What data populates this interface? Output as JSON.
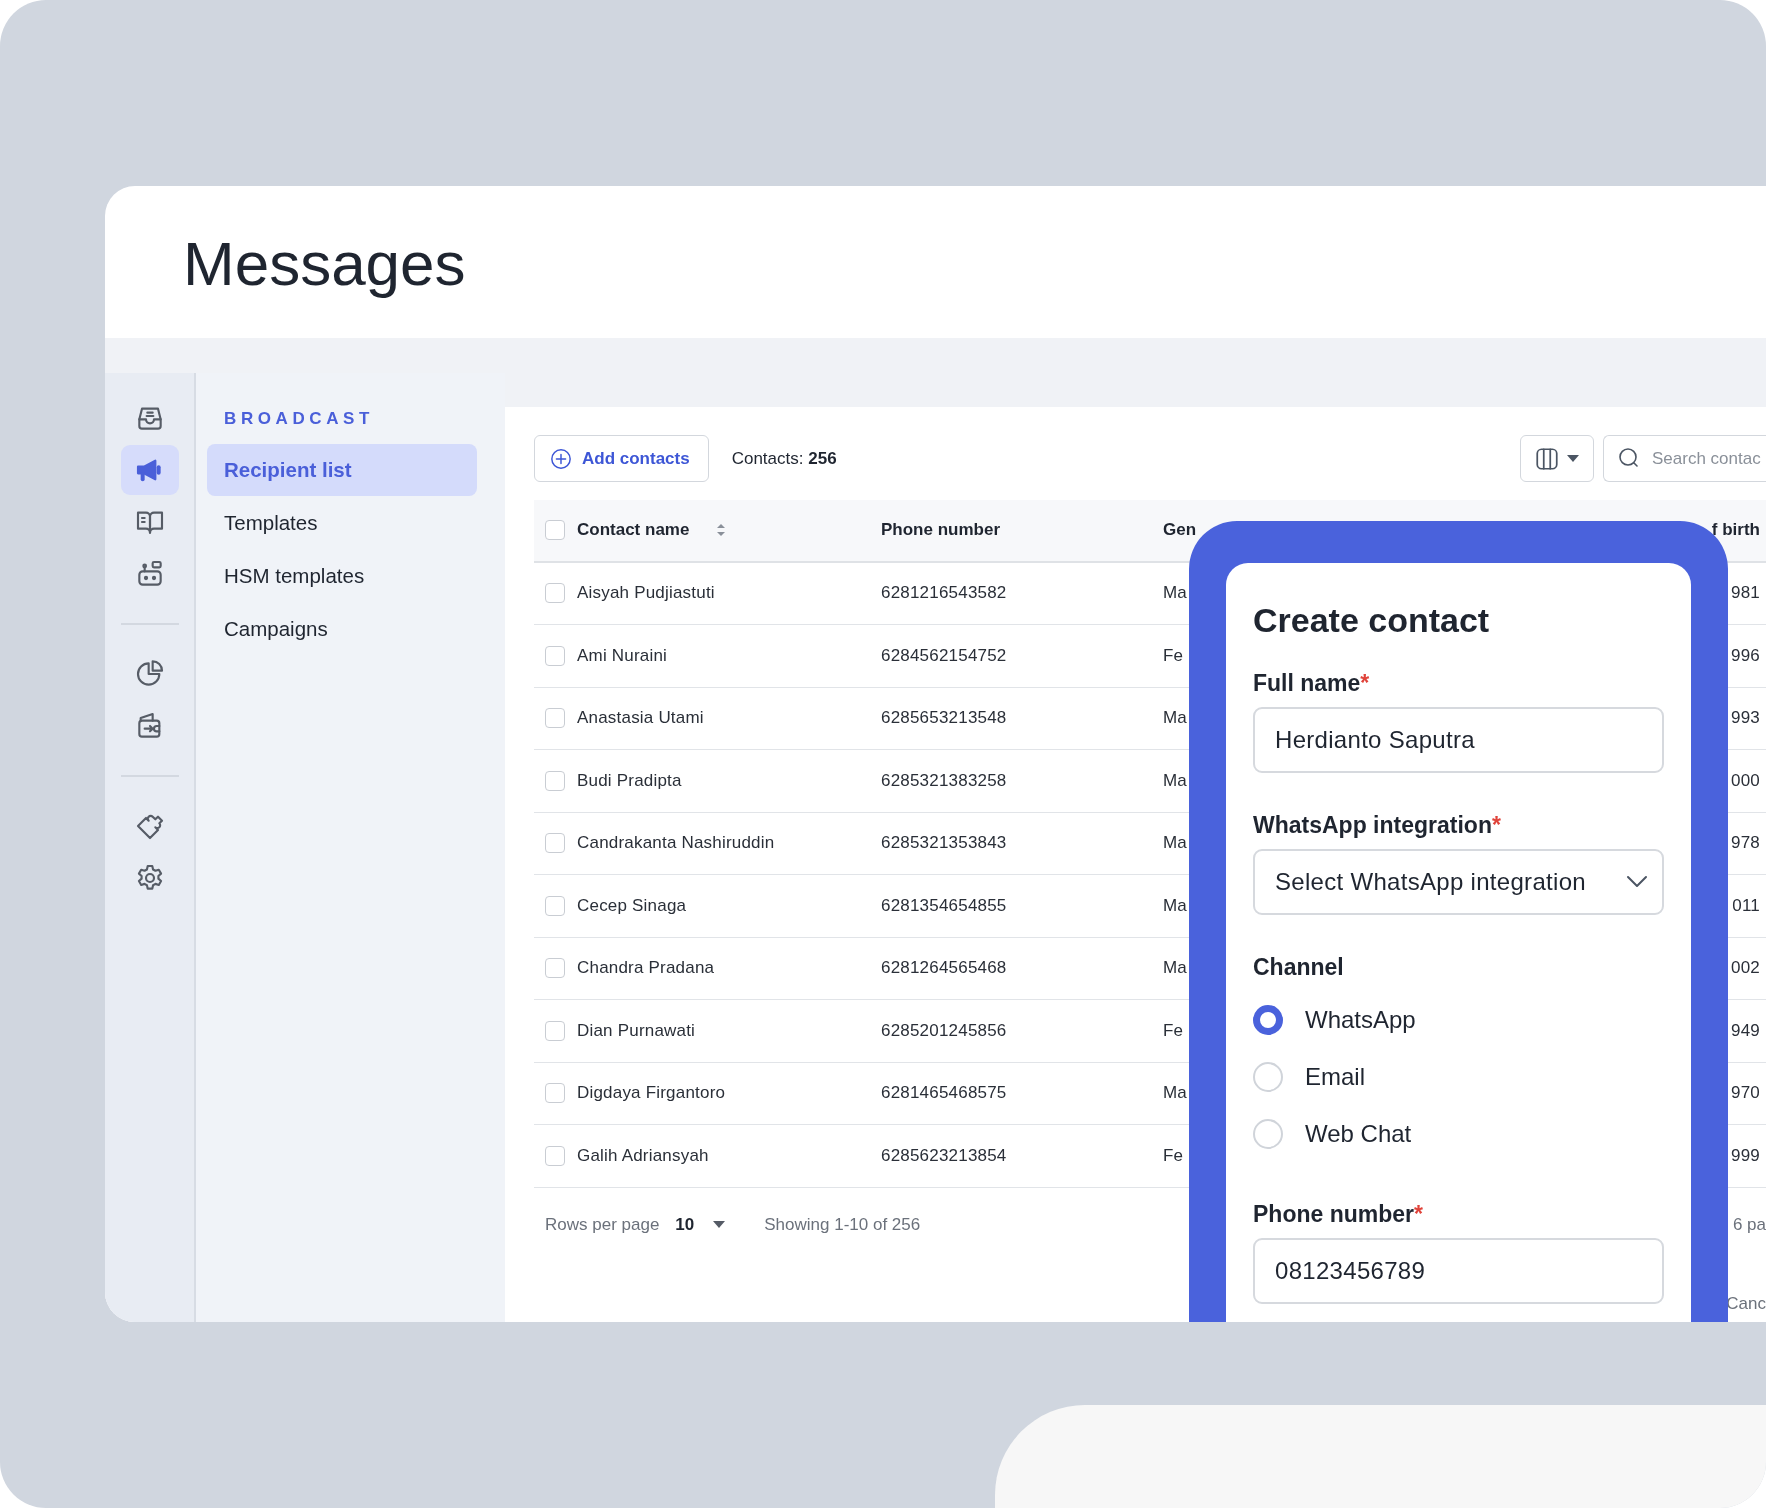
{
  "page_title": "Messages",
  "rail": {
    "groups": [
      [
        {
          "kind": "inbox",
          "selected": false
        },
        {
          "kind": "megaphone",
          "selected": true
        },
        {
          "kind": "book",
          "selected": false
        },
        {
          "kind": "robot",
          "selected": false
        }
      ],
      [
        {
          "kind": "pie",
          "selected": false
        },
        {
          "kind": "wallet",
          "selected": false
        }
      ],
      [
        {
          "kind": "puzzle",
          "selected": false
        },
        {
          "kind": "gear",
          "selected": false
        }
      ]
    ]
  },
  "subnav": {
    "heading": "BROADCAST",
    "items": [
      {
        "label": "Recipient list",
        "selected": true
      },
      {
        "label": "Templates",
        "selected": false
      },
      {
        "label": "HSM templates",
        "selected": false
      },
      {
        "label": "Campaigns",
        "selected": false
      }
    ]
  },
  "toolbar": {
    "add_button": "Add contacts",
    "contacts": "Contacts: **256**",
    "search": {
      "placeholder": "Search contac"
    }
  },
  "table": {
    "all_checked": false,
    "columns": [
      {
        "label": "Contact name",
        "sortable": true
      },
      {
        "label": "Phone number",
        "sortable": false
      },
      {
        "label": "Gen",
        "sortable": false
      },
      {
        "label": "f birth",
        "sortable": false
      }
    ],
    "rows": [
      {
        "checked": false,
        "cells": [
          "Aisyah Pudjiastuti",
          "6281216543582",
          "Ma",
          "981"
        ]
      },
      {
        "checked": false,
        "cells": [
          "Ami Nuraini",
          "6284562154752",
          "Fe",
          "996"
        ]
      },
      {
        "checked": false,
        "cells": [
          "Anastasia Utami",
          "6285653213548",
          "Ma",
          "993"
        ]
      },
      {
        "checked": false,
        "cells": [
          "Budi Pradipta",
          "6285321383258",
          "Ma",
          "000"
        ]
      },
      {
        "checked": false,
        "cells": [
          "Candrakanta Nashiruddin",
          "6285321353843",
          "Ma",
          "978"
        ]
      },
      {
        "checked": false,
        "cells": [
          "Cecep Sinaga",
          "6281354654855",
          "Ma",
          "011"
        ]
      },
      {
        "checked": false,
        "cells": [
          "Chandra Pradana",
          "6281264565468",
          "Ma",
          "002"
        ]
      },
      {
        "checked": false,
        "cells": [
          "Dian Purnawati",
          "6285201245856",
          "Fe",
          "949"
        ]
      },
      {
        "checked": false,
        "cells": [
          "Digdaya Firgantoro",
          "6281465468575",
          "Ma",
          "970"
        ]
      },
      {
        "checked": false,
        "cells": [
          "Galih Adriansyah",
          "6285623213854",
          "Fe",
          "999"
        ]
      }
    ]
  },
  "pagination": {
    "rows_per_page_label": "Rows per page",
    "rows_per_page": "10",
    "showing": "Showing 1-10 of 256",
    "column_4_text": "6 pa"
  },
  "footer_button": "Canc",
  "modal": {
    "title": "Create contact",
    "fields": [
      {
        "kind": "text",
        "label": "Full name",
        "required_mark": "*",
        "value": "Herdianto Saputra"
      },
      {
        "kind": "select",
        "label": "WhatsApp integration",
        "required_mark": "*",
        "value": "Select WhatsApp integration"
      },
      {
        "kind": "radio",
        "label": "Channel",
        "options": [
          {
            "label": "WhatsApp",
            "selected": true
          },
          {
            "label": "Email",
            "selected": false
          },
          {
            "label": "Web Chat",
            "selected": false
          }
        ]
      },
      {
        "kind": "text",
        "label": "Phone number",
        "required_mark": "*",
        "value": "08123456789"
      }
    ]
  }
}
